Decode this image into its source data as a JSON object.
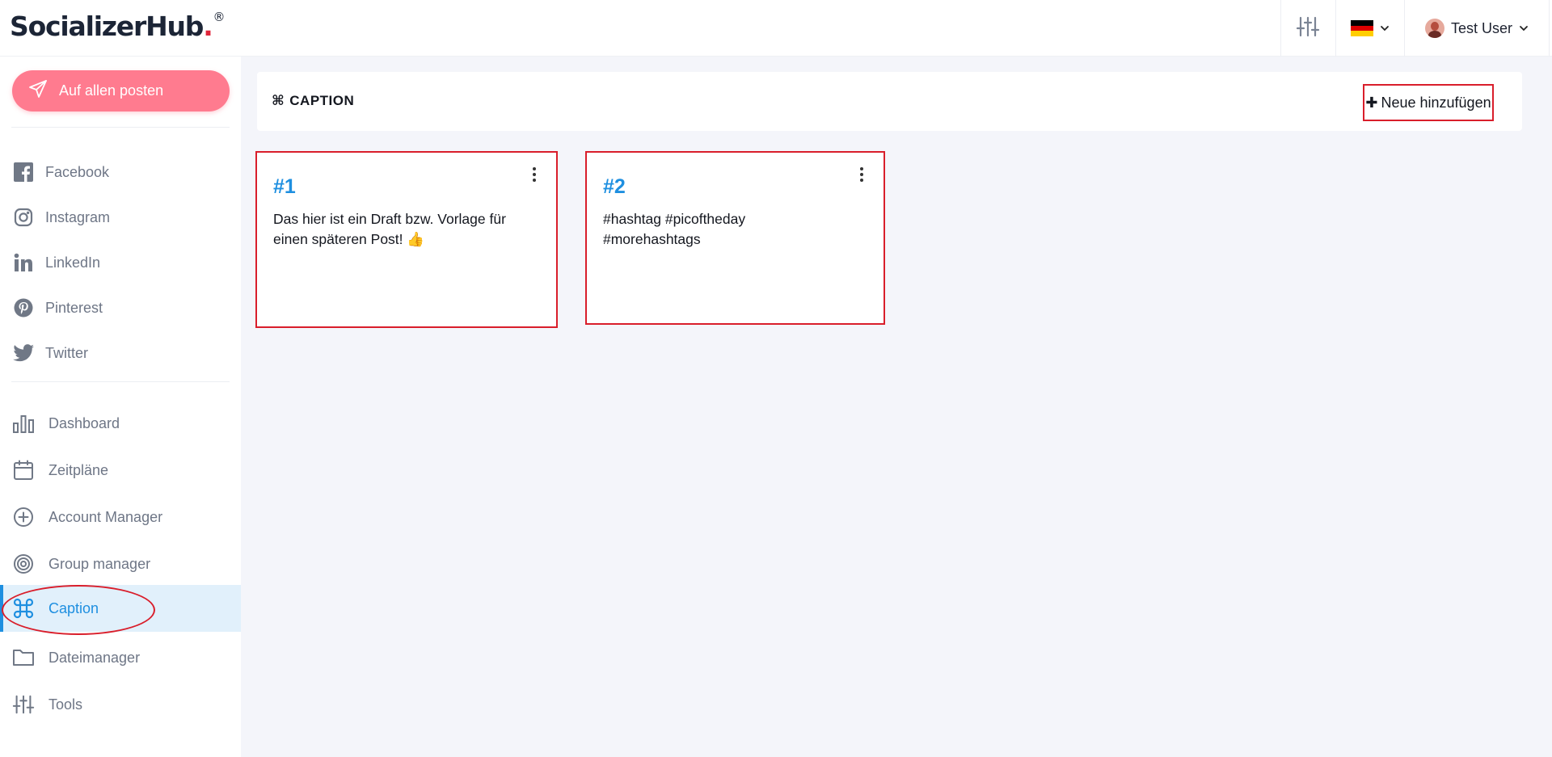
{
  "brand": {
    "name": "SocializerHub",
    "dot": ".",
    "reg": "®"
  },
  "header": {
    "language": {
      "flag_colors": [
        "#000000",
        "#dd0000",
        "#ffce00"
      ],
      "icon": "germany-flag-icon"
    },
    "user": {
      "name": "Test User"
    }
  },
  "sidebar": {
    "post_button": "Auf allen posten",
    "social": [
      {
        "label": "Facebook",
        "icon": "facebook-icon"
      },
      {
        "label": "Instagram",
        "icon": "instagram-icon"
      },
      {
        "label": "LinkedIn",
        "icon": "linkedin-icon"
      },
      {
        "label": "Pinterest",
        "icon": "pinterest-icon"
      },
      {
        "label": "Twitter",
        "icon": "twitter-icon"
      }
    ],
    "menu": [
      {
        "label": "Dashboard",
        "icon": "bar-chart-icon"
      },
      {
        "label": "Zeitpläne",
        "icon": "calendar-icon"
      },
      {
        "label": "Account Manager",
        "icon": "plus-circle-icon"
      },
      {
        "label": "Group manager",
        "icon": "target-icon"
      },
      {
        "label": "Caption",
        "icon": "command-icon",
        "active": true
      },
      {
        "label": "Dateimanager",
        "icon": "folder-icon"
      },
      {
        "label": "Tools",
        "icon": "sliders-icon"
      }
    ]
  },
  "main": {
    "title": "CAPTION",
    "title_symbol": "⌘",
    "add_button": "Neue hinzufügen",
    "add_symbol": "✚",
    "cards": [
      {
        "number": "#1",
        "text": "Das hier ist ein Draft bzw. Vorlage für einen späteren Post! 👍"
      },
      {
        "number": "#2",
        "text": "#hashtag #picoftheday #morehashtags"
      }
    ]
  },
  "colors": {
    "accent": "#1e8fe0",
    "post_button": "#ff7b8f",
    "highlight": "#d91e2b"
  }
}
